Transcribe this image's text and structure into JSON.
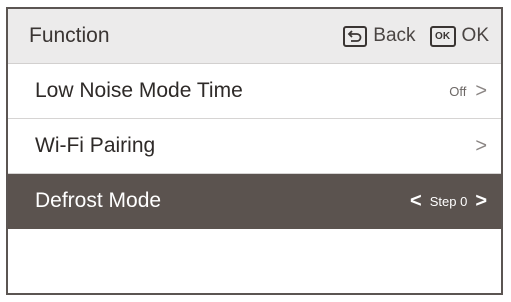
{
  "header": {
    "title": "Function",
    "back_label": "Back",
    "ok_icon_text": "OK",
    "ok_label": "OK"
  },
  "menu": {
    "items": [
      {
        "label": "Low Noise Mode Time",
        "value": "Off",
        "chevron": ">"
      },
      {
        "label": "Wi-Fi Pairing",
        "value": "",
        "chevron": ">"
      },
      {
        "label": "Defrost Mode",
        "value": "Step 0",
        "chevron_left": "<",
        "chevron": ">",
        "selected": true
      }
    ]
  },
  "colors": {
    "header_bg": "#ecebeb",
    "selected_bg": "#5b534f",
    "frame": "#5b5552"
  }
}
